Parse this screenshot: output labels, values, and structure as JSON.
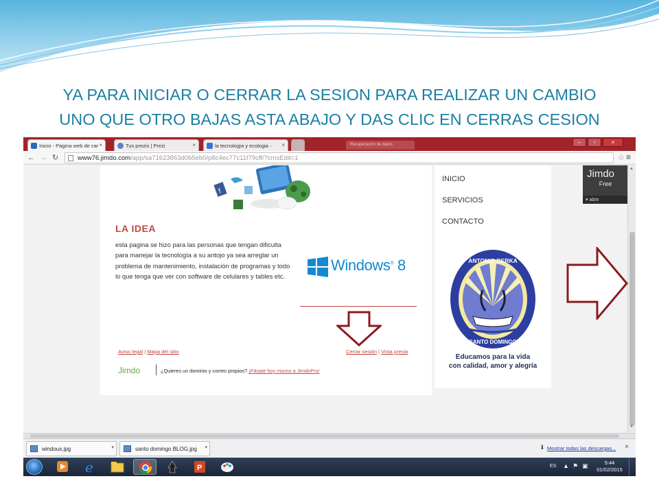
{
  "slide": {
    "title_line1": "YA PARA INICIAR O CERRAR LA SESION PARA REALIZAR UN CAMBIO",
    "title_line2": "UNO QUE OTRO BAJAS ASTA ABAJO Y DAS CLIC EN CERRAS CESION",
    "title_color": "#1a7fa3"
  },
  "browser": {
    "tabs": [
      {
        "label": "Inicio - Página web de car",
        "icon": "jimdo-favicon",
        "active": true
      },
      {
        "label": "Tus prezis | Prezi",
        "icon": "prezi-favicon",
        "active": false
      },
      {
        "label": "la tecnologia y ecologia -",
        "icon": "google-favicon",
        "active": false
      }
    ],
    "ghost_tab_label": "Recuperación de datos",
    "url_host": "www76.jimdo.com",
    "url_path": "/app/sa71623863d0b5eb0/p8c4ec77c11f79cff/?cmsEdit=1",
    "frame_color": "#a3232a"
  },
  "page": {
    "section_title": "LA IDEA",
    "paragraph": "esta pagina se hizo para las personas que tengan dificulta para manejar la tecnología a su antojo ya sea arreglar un problema de mantenimiento, instalación de programas y todo lo que tenga que ver con software de celulares y tables etc.",
    "windows_logo_text": "Windows",
    "windows_logo_version": "8",
    "footer_links": {
      "legal": "Aviso legal",
      "sitemap": "Mapa del sitio",
      "logout": "Cerrar sesión",
      "preview": "Vista previa",
      "separator": "|"
    },
    "jimdo_logo": "Jimdo",
    "promo_text": "¿Quieres un dominio y correo propios?",
    "promo_link": "¡Pásate hoy mismo a JimdoPro!",
    "accent_color": "#c4453f"
  },
  "sidebar": {
    "nav": [
      "INICIO",
      "SERVICIOS",
      "CONTACTO"
    ],
    "logo_ring_text_top": "ANTONIO DERKA",
    "logo_ring_text_bottom": "SANTO DOMINGO",
    "caption_line1": "Educamos para la vida",
    "caption_line2": "con calidad, amor y alegría"
  },
  "jimdo_badge": {
    "name": "Jimdo",
    "plan": "Free",
    "open_label": "abrir"
  },
  "downloads": {
    "items": [
      "windous.jpg",
      "santo domingo BLOG.jpg"
    ],
    "show_all": "Mostrar todas las descargas..."
  },
  "taskbar": {
    "apps": [
      "start-orb",
      "media-player",
      "internet-explorer",
      "file-explorer",
      "chrome",
      "inkscape",
      "powerpoint",
      "paint"
    ],
    "lang": "ES",
    "time": "5:44",
    "date": "01/02/2015"
  },
  "annotations": {
    "arrow_color": "#8b1a1f"
  }
}
